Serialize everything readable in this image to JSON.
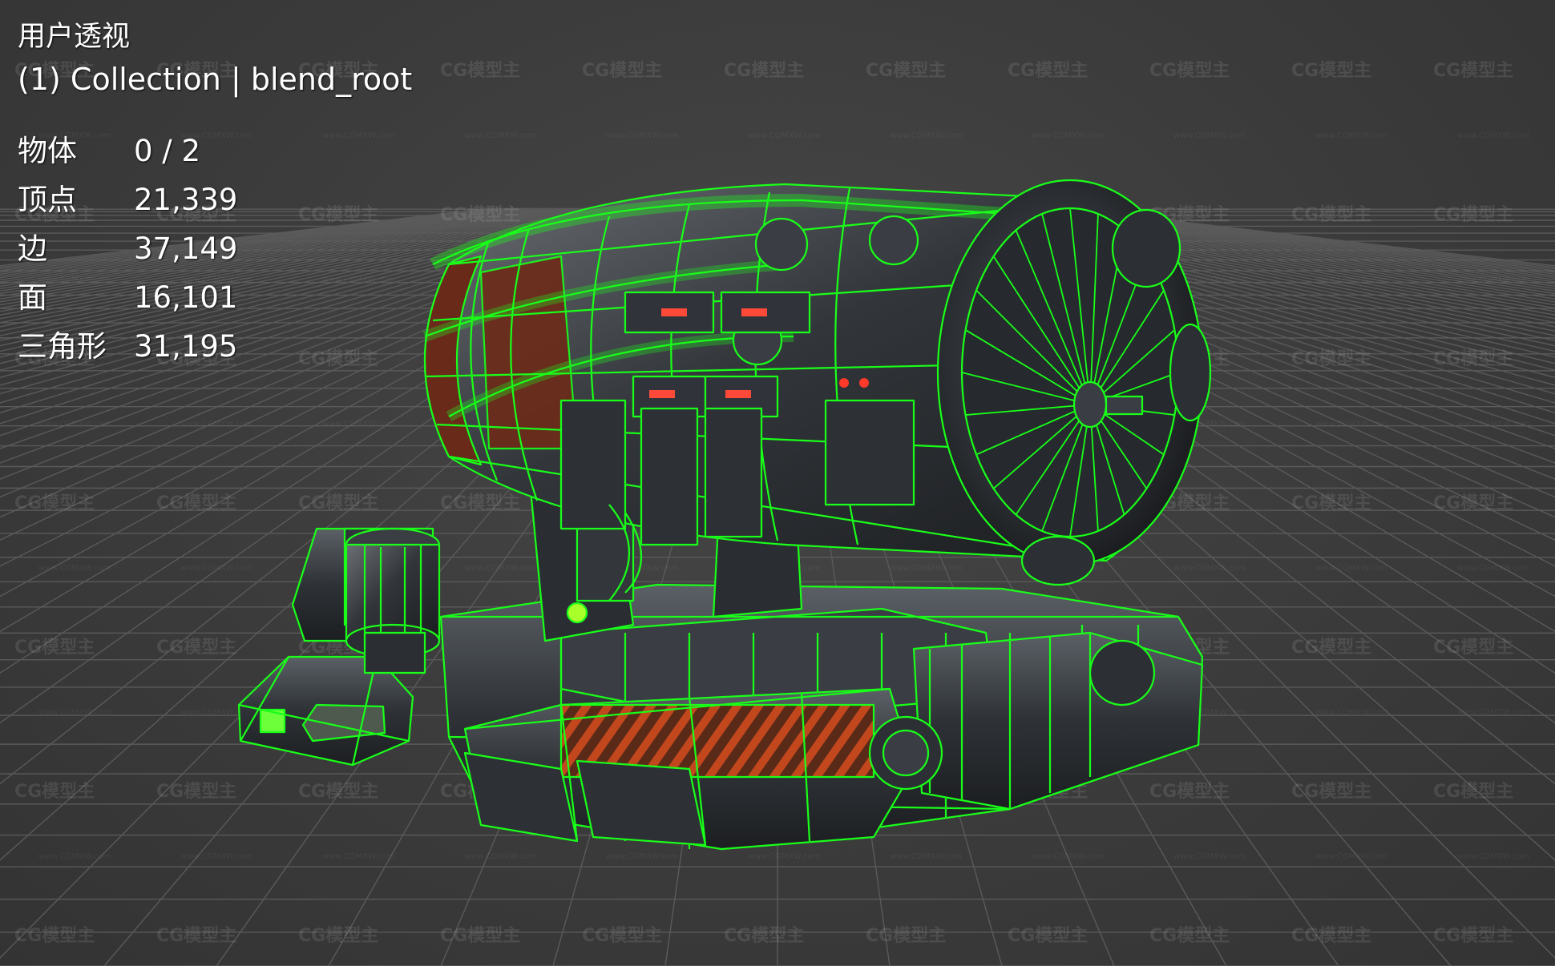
{
  "viewport": {
    "view_name": "用户透视",
    "collection_line": "(1) Collection | blend_root",
    "background_color": "#3b3b3b",
    "grid_color": "#5a5a5a",
    "wire_color": "#19ff19"
  },
  "stats": [
    {
      "label": "物体",
      "value": "0 / 2"
    },
    {
      "label": "顶点",
      "value": "21,339"
    },
    {
      "label": "边",
      "value": "37,149"
    },
    {
      "label": "面",
      "value": "16,101"
    },
    {
      "label": "三角形",
      "value": "31,195"
    }
  ],
  "watermark": {
    "text": "CG模型主",
    "url_text": "www.CGMXW.com"
  }
}
